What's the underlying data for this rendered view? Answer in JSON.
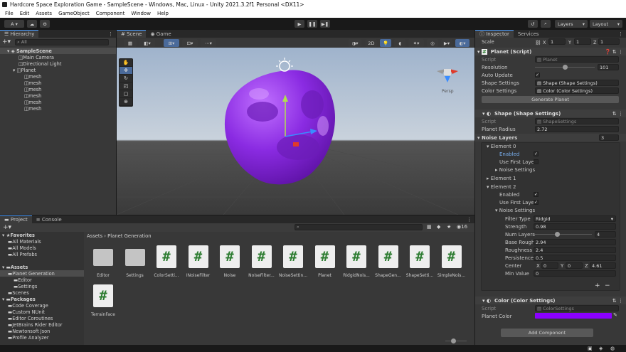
{
  "window": {
    "title": "Hardcore Space Exploration Game - SampleScene - Windows, Mac, Linux - Unity 2021.3.2f1 Personal <DX11>"
  },
  "menu": [
    "File",
    "Edit",
    "Assets",
    "GameObject",
    "Component",
    "Window",
    "Help"
  ],
  "toolbar": {
    "account": "A",
    "layers": "Layers",
    "layout": "Layout"
  },
  "hierarchy": {
    "tab": "Hierarchy",
    "search_placeholder": "All",
    "scene": "SampleScene",
    "items": [
      {
        "label": "Main Camera",
        "indent": 2
      },
      {
        "label": "Directional Light",
        "indent": 2
      },
      {
        "label": "Planet",
        "indent": 1
      },
      {
        "label": "mesh",
        "indent": 3
      },
      {
        "label": "mesh",
        "indent": 3
      },
      {
        "label": "mesh",
        "indent": 3
      },
      {
        "label": "mesh",
        "indent": 3
      },
      {
        "label": "mesh",
        "indent": 3
      },
      {
        "label": "mesh",
        "indent": 3
      }
    ]
  },
  "scene": {
    "tabs": [
      "Scene",
      "Game"
    ],
    "mode_2d": "2D",
    "persp": "Persp",
    "planet_color": "#8a2be2"
  },
  "project": {
    "tabs": [
      "Project",
      "Console"
    ],
    "breadcrumb": [
      "Assets",
      "Planet Generation"
    ],
    "count": "16",
    "tree": [
      {
        "label": "Favorites",
        "indent": 0,
        "bold": true
      },
      {
        "label": "All Materials",
        "indent": 1
      },
      {
        "label": "All Models",
        "indent": 1
      },
      {
        "label": "All Prefabs",
        "indent": 1
      },
      {
        "label": "",
        "indent": 0
      },
      {
        "label": "Assets",
        "indent": 0,
        "bold": true
      },
      {
        "label": "Planet Generation",
        "indent": 1,
        "selected": true
      },
      {
        "label": "Editor",
        "indent": 2
      },
      {
        "label": "Settings",
        "indent": 2
      },
      {
        "label": "Scenes",
        "indent": 1
      },
      {
        "label": "Packages",
        "indent": 0,
        "bold": true
      },
      {
        "label": "Code Coverage",
        "indent": 1
      },
      {
        "label": "Custom NUnit",
        "indent": 1
      },
      {
        "label": "Editor Coroutines",
        "indent": 1
      },
      {
        "label": "JetBrains Rider Editor",
        "indent": 1
      },
      {
        "label": "Newtonsoft Json",
        "indent": 1
      },
      {
        "label": "Profile Analyzer",
        "indent": 1
      }
    ],
    "assets": [
      {
        "name": "Editor",
        "kind": "folder"
      },
      {
        "name": "Settings",
        "kind": "folder"
      },
      {
        "name": "ColorSetti...",
        "kind": "script"
      },
      {
        "name": "INoiseFilter",
        "kind": "script"
      },
      {
        "name": "Noise",
        "kind": "script"
      },
      {
        "name": "NoiseFilter...",
        "kind": "script"
      },
      {
        "name": "NoiseSettin...",
        "kind": "script"
      },
      {
        "name": "Planet",
        "kind": "script"
      },
      {
        "name": "RidgidNois...",
        "kind": "script"
      },
      {
        "name": "ShapeGen...",
        "kind": "script"
      },
      {
        "name": "ShapeSetti...",
        "kind": "script"
      },
      {
        "name": "SimpleNois...",
        "kind": "script"
      },
      {
        "name": "TerrainFace",
        "kind": "script"
      }
    ]
  },
  "inspector": {
    "tabs": [
      "Inspector",
      "Services"
    ],
    "scale": {
      "label": "Scale",
      "x": "1",
      "y": "1",
      "z": "1"
    },
    "planet_script": {
      "title": "Planet (Script)",
      "script_label": "Script",
      "script_value": "Planet",
      "resolution_label": "Resolution",
      "resolution_value": "101",
      "resolution_fraction": 0.5,
      "auto_update_label": "Auto Update",
      "shape_label": "Shape Settings",
      "shape_value": "Shape (Shape Settings)",
      "color_label": "Color Settings",
      "color_value": "Color (Color Settings)",
      "generate": "Generate Planet"
    },
    "shape": {
      "title": "Shape (Shape Settings)",
      "script_label": "Script",
      "script_value": "ShapeSettings",
      "radius_label": "Planet Radius",
      "radius_value": "2.72",
      "layers_label": "Noise Layers",
      "layers_value": "3",
      "e0": "Element 0",
      "enabled": "Enabled",
      "use_first": "Use First Laye",
      "noise_settings": "Noise Settings",
      "e1": "Element 1",
      "e2": "Element 2",
      "filter_label": "Filter Type",
      "filter_value": "Ridgid",
      "strength_label": "Strength",
      "strength_value": "0.98",
      "num_layers_label": "Num Layers",
      "num_layers_value": "4",
      "num_layers_fraction": 0.4,
      "base_label": "Base Rough",
      "base_value": "2.94",
      "rough_label": "Roughness",
      "rough_value": "2.4",
      "persist_label": "Persistence",
      "persist_value": "0.5",
      "center_label": "Center",
      "cx": "0",
      "cy": "0",
      "cz": "4.61",
      "min_label": "Min Value",
      "min_value": "0"
    },
    "color": {
      "title": "Color (Color Settings)",
      "script_label": "Script",
      "script_value": "ColorSettings",
      "planet_color_label": "Planet Color",
      "swatch": "#8a00ff"
    },
    "add_component": "Add Component"
  }
}
